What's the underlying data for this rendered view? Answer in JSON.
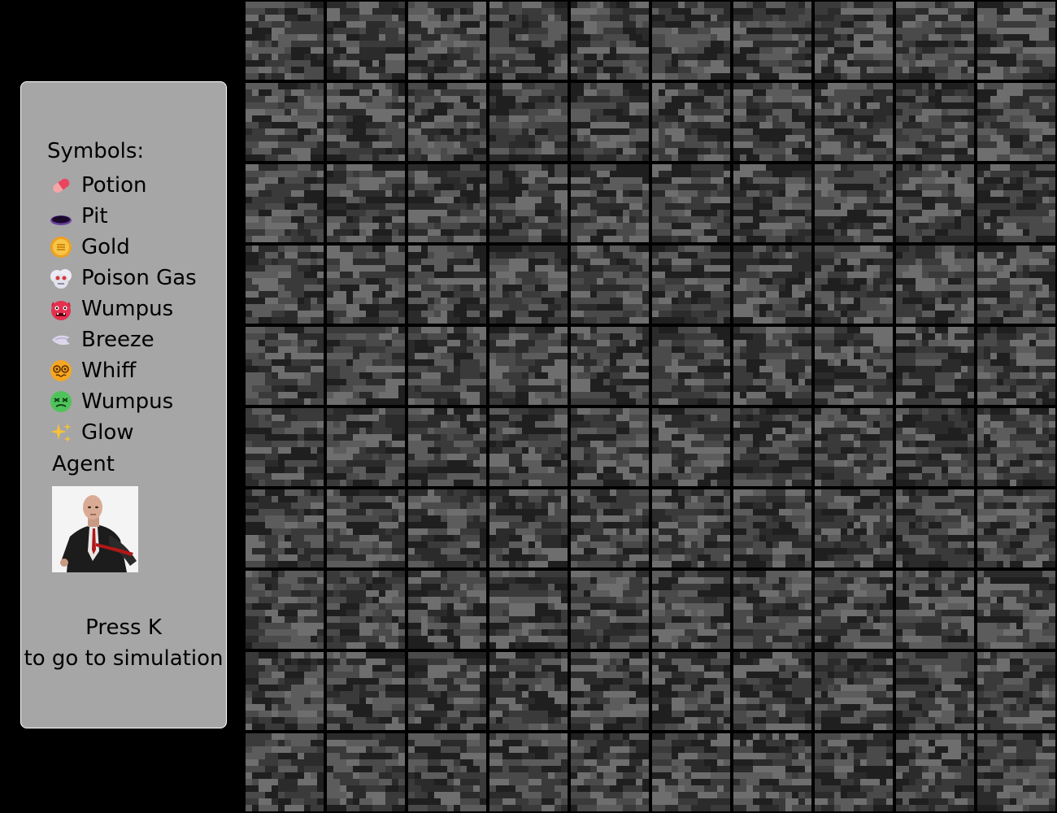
{
  "legend": {
    "title": "Symbols:",
    "items": [
      {
        "label": "Potion",
        "icon": "potion-icon"
      },
      {
        "label": "Pit",
        "icon": "pit-icon"
      },
      {
        "label": "Gold",
        "icon": "gold-coin-icon"
      },
      {
        "label": "Poison Gas",
        "icon": "poison-gas-cloud-icon"
      },
      {
        "label": "Wumpus",
        "icon": "wumpus-ogre-icon"
      },
      {
        "label": "Breeze",
        "icon": "breeze-wind-icon"
      },
      {
        "label": "Whiff",
        "icon": "whiff-dizzy-face-icon"
      },
      {
        "label": "Wumpus",
        "icon": "wumpus-nauseated-face-icon"
      },
      {
        "label": "Glow",
        "icon": "glow-sparkles-icon"
      }
    ],
    "agent_label": "Agent",
    "agent_icon": "agent-portrait-icon",
    "press_line1": "Press K",
    "press_line2": "to go to simulation"
  },
  "grid": {
    "rows": 10,
    "cols": 10,
    "tile": "bedrock-stone-tile"
  },
  "colors": {
    "background": "#000000",
    "panel": "#a6a6a6",
    "panel_border": "#ffffff",
    "stone_shades": [
      "#1f1f1f",
      "#2b2b2b",
      "#3a3a3a",
      "#4a4a4a",
      "#5c5c5c",
      "#6e6e6e"
    ]
  }
}
